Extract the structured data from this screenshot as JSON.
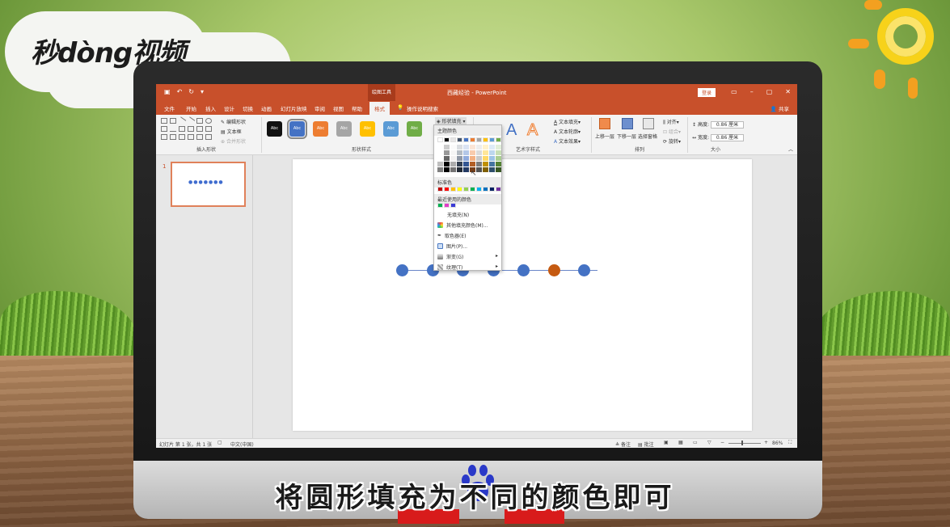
{
  "logo": {
    "text": "秒dòng视频"
  },
  "titlebar": {
    "context_tools": "绘图工具",
    "doc_title": "西藏经验 - PowerPoint",
    "login": "登录",
    "qat_icons": [
      "save-icon",
      "undo-icon",
      "redo-icon",
      "customize-icon"
    ]
  },
  "tabs": [
    {
      "label": "文件"
    },
    {
      "label": "开始"
    },
    {
      "label": "插入"
    },
    {
      "label": "设计"
    },
    {
      "label": "切换"
    },
    {
      "label": "动画"
    },
    {
      "label": "幻灯片放映"
    },
    {
      "label": "审阅"
    },
    {
      "label": "视图"
    },
    {
      "label": "帮助"
    },
    {
      "label": "格式",
      "active": true
    }
  ],
  "tell_me": "操作说明搜索",
  "share": "共享",
  "ribbon": {
    "insert_shapes": {
      "label": "插入形状",
      "edit_shape": "编辑形状",
      "text_box": "文本框",
      "merge_shapes": "合并形状"
    },
    "shape_styles": {
      "label": "形状样式",
      "swatch_text": "Abc",
      "swatches": [
        "#111111",
        "#4472c4",
        "#ed7d31",
        "#a5a5a5",
        "#ffc000",
        "#5b9bd5",
        "#70ad47"
      ],
      "fill_button": "形状填充"
    },
    "wordart": {
      "label": "艺术字样式",
      "glyph": "A",
      "text_fill": "文本填充",
      "text_outline": "文本轮廓",
      "text_effects": "文本效果"
    },
    "arrange": {
      "label": "排列",
      "bring_forward": "上移一层",
      "send_backward": "下移一层",
      "selection_pane": "选择窗格",
      "align": "对齐",
      "group": "组合",
      "rotate": "旋转"
    },
    "size": {
      "label": "大小",
      "height_label": "高度:",
      "height": "0.86 厘米",
      "width_label": "宽度:",
      "width": "0.86 厘米"
    }
  },
  "dropdown": {
    "theme_colors_label": "主题颜色",
    "standard_colors_label": "标准色",
    "recent_colors_label": "最近使用的颜色",
    "theme_top_row": [
      "#ffffff",
      "#000000",
      "#e7e6e6",
      "#44546a",
      "#4472c4",
      "#ed7d31",
      "#a5a5a5",
      "#ffc000",
      "#5b9bd5",
      "#70ad47"
    ],
    "standard_colors": [
      "#c00000",
      "#ff0000",
      "#ffc000",
      "#ffff00",
      "#92d050",
      "#00b050",
      "#00b0f0",
      "#0070c0",
      "#002060",
      "#7030a0"
    ],
    "recent_colors": [
      "#00b050",
      "#e03cc8",
      "#3b3bd6"
    ],
    "items": [
      {
        "label": "无填充(N)",
        "icon": "none"
      },
      {
        "label": "其他填充颜色(M)...",
        "icon": "palette-icon"
      },
      {
        "label": "取色器(E)",
        "icon": "eyedropper-icon"
      },
      {
        "label": "图片(P)...",
        "icon": "picture-icon"
      },
      {
        "label": "渐变(G)",
        "icon": "gradient-icon",
        "submenu": true
      },
      {
        "label": "纹理(T)",
        "icon": "texture-icon",
        "submenu": true
      }
    ]
  },
  "thumbnails": [
    {
      "number": "1",
      "dots": "●●●●●●●"
    }
  ],
  "slide": {
    "circles": [
      {
        "color": "#4472c4"
      },
      {
        "color": "#4472c4"
      },
      {
        "color": "#4472c4"
      },
      {
        "color": "#4472c4"
      },
      {
        "color": "#4472c4"
      },
      {
        "color": "#c55a11"
      },
      {
        "color": "#4472c4"
      }
    ]
  },
  "status": {
    "slide_info": "幻灯片 第 1 张，共 1 张",
    "language": "中文(中国)",
    "notes": "备注",
    "comments": "批注",
    "zoom": "86%"
  },
  "subtitle": "将圆形填充为不同的颜色即可"
}
